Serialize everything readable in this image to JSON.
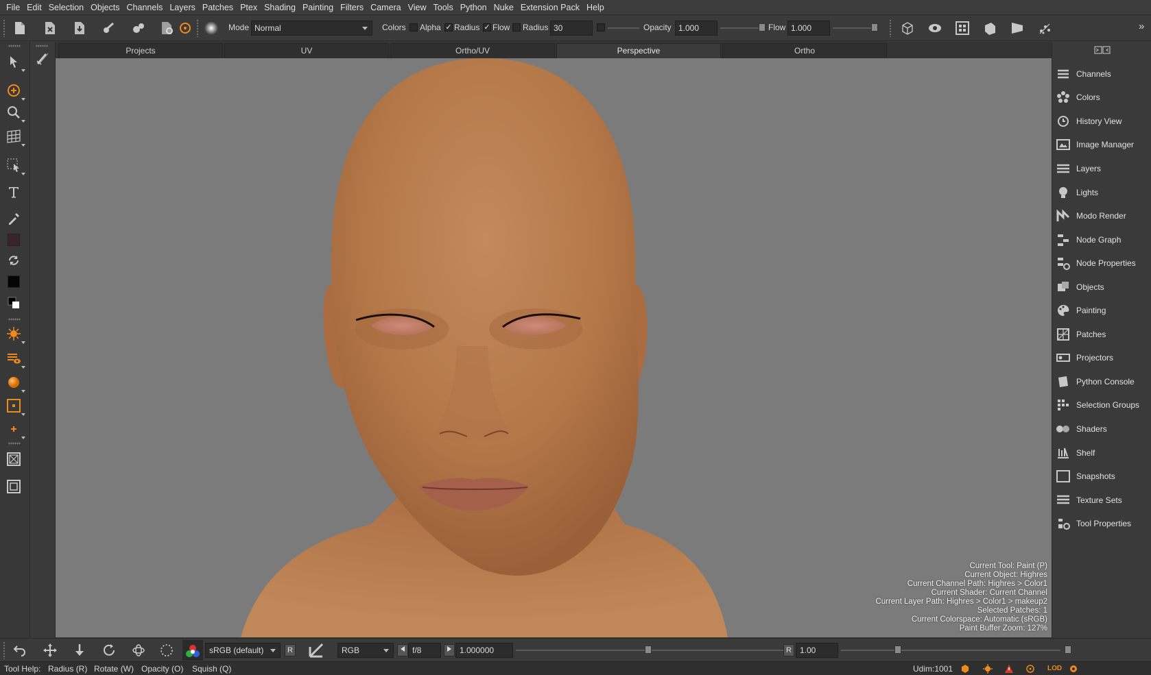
{
  "menu": [
    "File",
    "Edit",
    "Selection",
    "Objects",
    "Channels",
    "Layers",
    "Patches",
    "Ptex",
    "Shading",
    "Painting",
    "Filters",
    "Camera",
    "View",
    "Tools",
    "Python",
    "Nuke",
    "Extension Pack",
    "Help"
  ],
  "toolbar": {
    "mode_label": "Mode",
    "mode_value": "Normal",
    "colors_label": "Colors",
    "alpha_label": "Alpha",
    "radius_check_label": "Radius",
    "flow_check_label": "Flow",
    "radius_label": "Radius",
    "radius_value": "30",
    "opacity_label": "Opacity",
    "opacity_value": "1.000",
    "flow_label": "Flow",
    "flow_value": "1.000",
    "check_mark": "✓",
    "overflow": "»"
  },
  "tabs": [
    "Projects",
    "UV",
    "Ortho/UV",
    "Perspective",
    "Ortho"
  ],
  "active_tab": "Perspective",
  "hud": {
    "lines": [
      "Current Tool: Paint (P)",
      "Current Object: Highres",
      "Current Channel Path: Highres > Color1",
      "Current Shader: Current Channel",
      "Current Layer Path: Highres > Color1 > makeup2",
      "Selected Patches: 1",
      "Current Colorspace: Automatic (sRGB)",
      "Paint Buffer Zoom: 127%"
    ]
  },
  "right_panel": {
    "items": [
      {
        "label": "Channels",
        "icon": "channels-icon"
      },
      {
        "label": "Colors",
        "icon": "colors-icon"
      },
      {
        "label": "History View",
        "icon": "history-icon"
      },
      {
        "label": "Image Manager",
        "icon": "image-manager-icon"
      },
      {
        "label": "Layers",
        "icon": "layers-icon"
      },
      {
        "label": "Lights",
        "icon": "lights-icon"
      },
      {
        "label": "Modo Render",
        "icon": "modo-render-icon"
      },
      {
        "label": "Node Graph",
        "icon": "node-graph-icon"
      },
      {
        "label": "Node Properties",
        "icon": "node-properties-icon"
      },
      {
        "label": "Objects",
        "icon": "objects-icon"
      },
      {
        "label": "Painting",
        "icon": "painting-icon"
      },
      {
        "label": "Patches",
        "icon": "patches-icon"
      },
      {
        "label": "Projectors",
        "icon": "projectors-icon"
      },
      {
        "label": "Python Console",
        "icon": "python-console-icon"
      },
      {
        "label": "Selection Groups",
        "icon": "selection-groups-icon"
      },
      {
        "label": "Shaders",
        "icon": "shaders-icon"
      },
      {
        "label": "Shelf",
        "icon": "shelf-icon"
      },
      {
        "label": "Snapshots",
        "icon": "snapshots-icon"
      },
      {
        "label": "Texture Sets",
        "icon": "texture-sets-icon"
      },
      {
        "label": "Tool Properties",
        "icon": "tool-properties-icon"
      }
    ]
  },
  "bottom": {
    "colorspace": "sRGB (default)",
    "r_button": "R",
    "channel": "RGB",
    "fstop": "f/8",
    "gain": "1.000000",
    "r_button2": "R",
    "gamma": "1.00"
  },
  "status": {
    "tool_help_label": "Tool Help:",
    "hints": [
      "Radius (R)",
      "Rotate (W)",
      "Opacity (O)",
      "Squish (Q)"
    ],
    "udim": "Udim:1001",
    "lod": "LOD"
  },
  "colors": {
    "accent_orange": "#f08a1c",
    "viewport_bg": "#7b7b7b",
    "skin": "#b87a4e",
    "warning_red": "#d63b2b"
  }
}
